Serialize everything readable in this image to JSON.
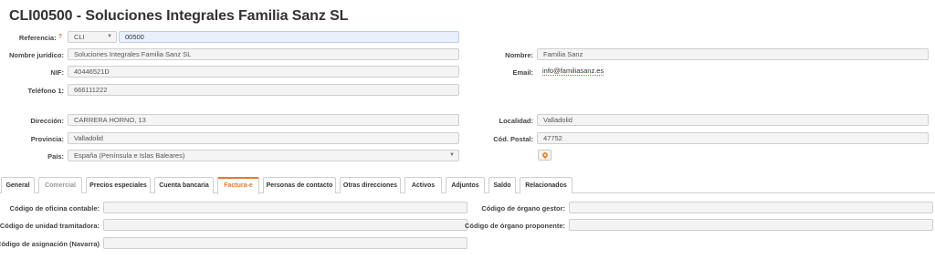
{
  "title": "CLI00500 - Soluciones Integrales Familia Sanz SL",
  "form": {
    "referencia_label": "Referencia:",
    "required_mark": "?",
    "referencia_prefix": "CLI",
    "referencia_value": "00500",
    "nombre_juridico_label": "Nombre jurídico:",
    "nombre_juridico_value": "Soluciones Integrales Familia Sanz SL",
    "nombre_label": "Nombre:",
    "nombre_value": "Familia Sanz",
    "nif_label": "NIF:",
    "nif_value": "40446521D",
    "email_label": "Email:",
    "email_value": "info@familiasanz.es",
    "telefono_label": "Teléfono 1:",
    "telefono_value": "666111222",
    "direccion_label": "Dirección:",
    "direccion_value": "CARRERA HORNO, 13",
    "localidad_label": "Localidad:",
    "localidad_value": "Valladolid",
    "provincia_label": "Provincia:",
    "provincia_value": "Valladolid",
    "cod_postal_label": "Cód. Postal:",
    "cod_postal_value": "47752",
    "pais_label": "País:",
    "pais_value": "España (Península e Islas Baleares)"
  },
  "tabs": [
    {
      "label": "General"
    },
    {
      "label": "Comercial"
    },
    {
      "label": "Precios especiales"
    },
    {
      "label": "Cuenta bancaria"
    },
    {
      "label": "Factura-e"
    },
    {
      "label": "Personas de contacto"
    },
    {
      "label": "Otras direcciones"
    },
    {
      "label": "Activos"
    },
    {
      "label": "Adjuntos"
    },
    {
      "label": "Saldo"
    },
    {
      "label": "Relacionados"
    }
  ],
  "factura": {
    "oficina_contable_label": "Código de oficina contable:",
    "organo_gestor_label": "Código de órgano gestor:",
    "unidad_tramitadora_label": "Código de unidad tramitadora:",
    "organo_proponente_label": "Código de órgano proponente:",
    "asignacion_label": "Código de asignación (Navarra)"
  }
}
